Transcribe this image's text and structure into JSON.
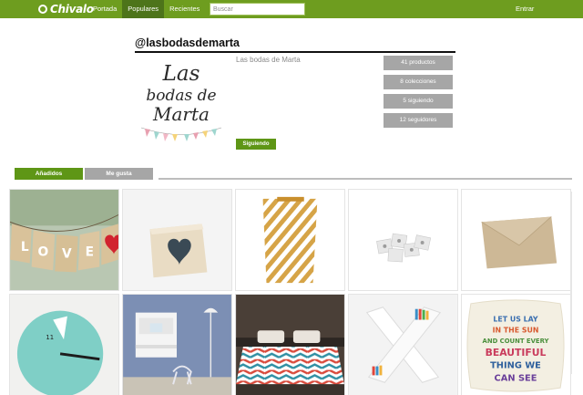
{
  "header": {
    "logo_text": "Chivalo",
    "nav": [
      {
        "label": "Portada",
        "active": false
      },
      {
        "label": "Populares",
        "active": true
      },
      {
        "label": "Recientes",
        "active": false
      }
    ],
    "search_placeholder": "Buscar",
    "login_label": "Entrar"
  },
  "profile": {
    "username": "@lasbodasdemarta",
    "display_name": "Las bodas de Marta",
    "avatar_text": [
      "Las",
      "bodas de",
      "Marta"
    ],
    "follow_label": "Siguiendo",
    "stats": [
      "41 productos",
      "8 colecciones",
      "5 siguiendo",
      "12 seguidores"
    ]
  },
  "tabs": [
    {
      "label": "Añadidos",
      "active": true
    },
    {
      "label": "Me gusta",
      "active": false
    }
  ],
  "products": [
    {
      "name": "love-banner"
    },
    {
      "name": "heart-box"
    },
    {
      "name": "striped-bag"
    },
    {
      "name": "tea-bags"
    },
    {
      "name": "kraft-envelope"
    },
    {
      "name": "mint-clock",
      "clock_number": "11"
    },
    {
      "name": "wall-desk"
    },
    {
      "name": "chevron-bed"
    },
    {
      "name": "x-bookshelf"
    },
    {
      "name": "quote-pillow",
      "pillow_text": [
        "LET US LAY",
        "IN THE SUN",
        "AND COUNT EVERY",
        "BEAUTIFUL",
        "THING WE",
        "CAN SEE"
      ]
    }
  ],
  "colors": {
    "brand_green": "#6e9d1f",
    "nav_active": "#4d741a",
    "button_green": "#5e9616",
    "stat_gray": "#a6a6a6"
  }
}
